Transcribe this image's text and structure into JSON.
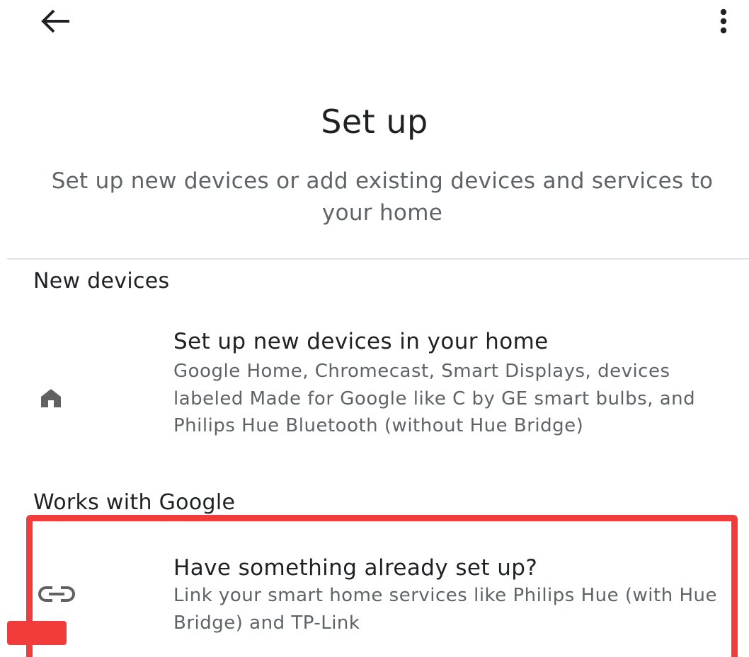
{
  "header": {
    "back_icon": "arrow-back-icon",
    "more_icon": "more-vert-icon"
  },
  "page": {
    "title": "Set up",
    "subtitle": "Set up new devices or add existing devices and services to your home"
  },
  "sections": {
    "new_devices": {
      "header": "New devices",
      "item": {
        "icon": "home-icon",
        "title": "Set up new devices in your home",
        "description": "Google Home, Chromecast, Smart Displays, devices labeled Made for Google like C by GE smart bulbs, and Philips Hue Bluetooth (without Hue Bridge)"
      }
    },
    "works_with_google": {
      "header": "Works with Google",
      "item": {
        "icon": "link-icon",
        "title": "Have something already set up?",
        "description": "Link your smart home services like Philips Hue (with Hue Bridge) and TP-Link"
      }
    }
  },
  "colors": {
    "primary_text": "#202124",
    "secondary_text": "#5f6368",
    "icon_gray": "#616161",
    "highlight": "#f23b3b"
  }
}
